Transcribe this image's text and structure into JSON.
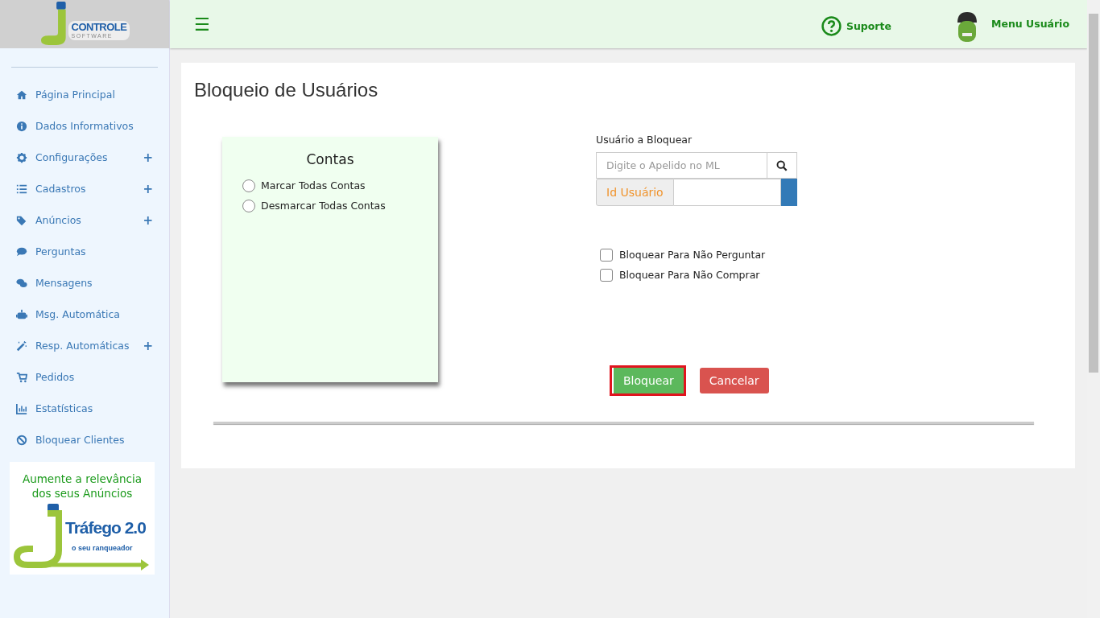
{
  "logo": {
    "brand": "CONTROLE",
    "tagline": "SOFTWARE"
  },
  "header": {
    "menu_icon": "☰",
    "support": "Suporte",
    "user_menu": "Menu Usuário"
  },
  "sidebar": {
    "items": [
      {
        "label": "Página Principal"
      },
      {
        "label": "Dados Informativos"
      },
      {
        "label": "Configurações",
        "expander": "+"
      },
      {
        "label": "Cadastros",
        "expander": "+"
      },
      {
        "label": "Anúncios",
        "expander": "+"
      },
      {
        "label": "Perguntas"
      },
      {
        "label": "Mensagens"
      },
      {
        "label": "Msg. Automática"
      },
      {
        "label": "Resp. Automáticas",
        "expander": "+"
      },
      {
        "label": "Pedidos"
      },
      {
        "label": "Estatísticas"
      },
      {
        "label": "Bloquear Clientes"
      }
    ],
    "banner": {
      "headline": "Aumente a relevância dos seus Anúncios",
      "product": "Tráfego 2.0",
      "slogan": "o seu ranqueador"
    }
  },
  "page": {
    "title": "Bloqueio de Usuários",
    "accounts": {
      "title": "Contas",
      "options": [
        {
          "label": "Marcar Todas Contas",
          "selected": false
        },
        {
          "label": "Desmarcar Todas Contas",
          "selected": false
        }
      ]
    },
    "user_label": "Usuário a Bloquear",
    "search": {
      "placeholder": "Digite o Apelido no ML"
    },
    "id_label": "Id Usuário",
    "checks": [
      {
        "label": "Bloquear Para Não Perguntar",
        "checked": false
      },
      {
        "label": "Bloquear Para Não Comprar",
        "checked": false
      }
    ],
    "buttons": [
      {
        "label": "Bloquear",
        "kind": "primary",
        "focused": true
      },
      {
        "label": "Cancelar",
        "kind": "danger",
        "focused": false
      }
    ]
  }
}
